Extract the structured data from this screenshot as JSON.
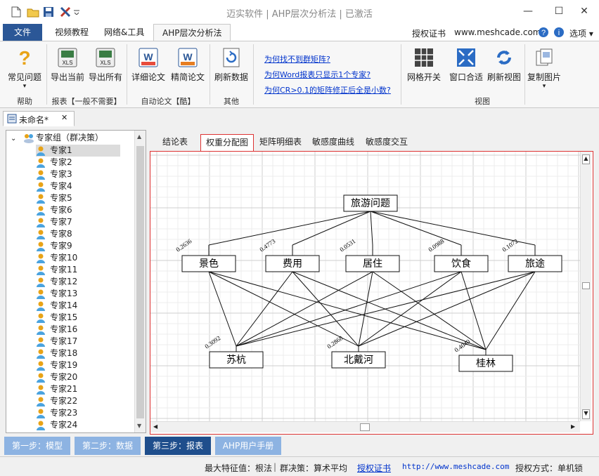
{
  "window": {
    "title": "迈实软件 | AHP层次分析法 | 已激活"
  },
  "ribbon_tabs": [
    "文件",
    "视频教程",
    "网络&工具",
    "AHP层次分析法"
  ],
  "ribbon_right": {
    "license": "授权证书",
    "site": "www.meshcade.com",
    "options": "选项"
  },
  "ribbon": {
    "help_group": {
      "button": "常见问题",
      "label": "帮助"
    },
    "report_group": {
      "export_current": "导出当前",
      "export_all": "导出所有",
      "label": "报表【一般不需要】"
    },
    "paper_group": {
      "detailed": "详细论文",
      "brief": "精简论文",
      "label": "自动论文【酷】"
    },
    "other_group": {
      "refresh": "刷新数据",
      "label": "其他"
    },
    "links": [
      "为何找不到群矩阵?",
      "为何Word报表只显示1个专家?",
      "为何CR>0.1的矩阵修正后全是小数?"
    ],
    "view_group": {
      "grid": "网格开关",
      "fit": "窗口合适",
      "refresh_view": "刷新视图",
      "copy_image": "复制图片",
      "label": "视图"
    }
  },
  "doc_tab": {
    "label": "未命名*"
  },
  "tree": {
    "root": "专家组（群决策）",
    "experts": [
      "专家1",
      "专家2",
      "专家3",
      "专家4",
      "专家5",
      "专家6",
      "专家7",
      "专家8",
      "专家9",
      "专家10",
      "专家11",
      "专家12",
      "专家13",
      "专家14",
      "专家15",
      "专家16",
      "专家17",
      "专家18",
      "专家19",
      "专家20",
      "专家21",
      "专家22",
      "专家23",
      "专家24"
    ],
    "selected_index": 0
  },
  "report_tabs": [
    "结论表",
    "权重分配图",
    "矩阵明细表",
    "敏感度曲线",
    "敏感度交互"
  ],
  "active_report_tab": 1,
  "diagram": {
    "goal": "旅游问题",
    "criteria": [
      {
        "name": "景色",
        "weight": "0.2636"
      },
      {
        "name": "费用",
        "weight": "0.4773"
      },
      {
        "name": "居住",
        "weight": "0.0531"
      },
      {
        "name": "饮食",
        "weight": "0.0988"
      },
      {
        "name": "旅途",
        "weight": "0.1072"
      }
    ],
    "alternatives": [
      {
        "name": "苏杭",
        "weight": "0.3092"
      },
      {
        "name": "北戴河",
        "weight": "0.2868"
      },
      {
        "name": "桂林",
        "weight": "0.4040"
      }
    ]
  },
  "steps": [
    "第一步：模型",
    "第二步：数据",
    "第三步：报表",
    "AHP用户手册"
  ],
  "active_step": 2,
  "status": {
    "eigen": "最大特征值：根法",
    "group": "群决策：算术平均",
    "license": "授权证书",
    "url": "http://www.meshcade.com",
    "auth": "授权方式：单机锁"
  },
  "colors": {
    "accent": "#2b5797",
    "highlight_border": "#dd3333",
    "step_active": "#1f4e8c",
    "step": "#8db3e2"
  }
}
